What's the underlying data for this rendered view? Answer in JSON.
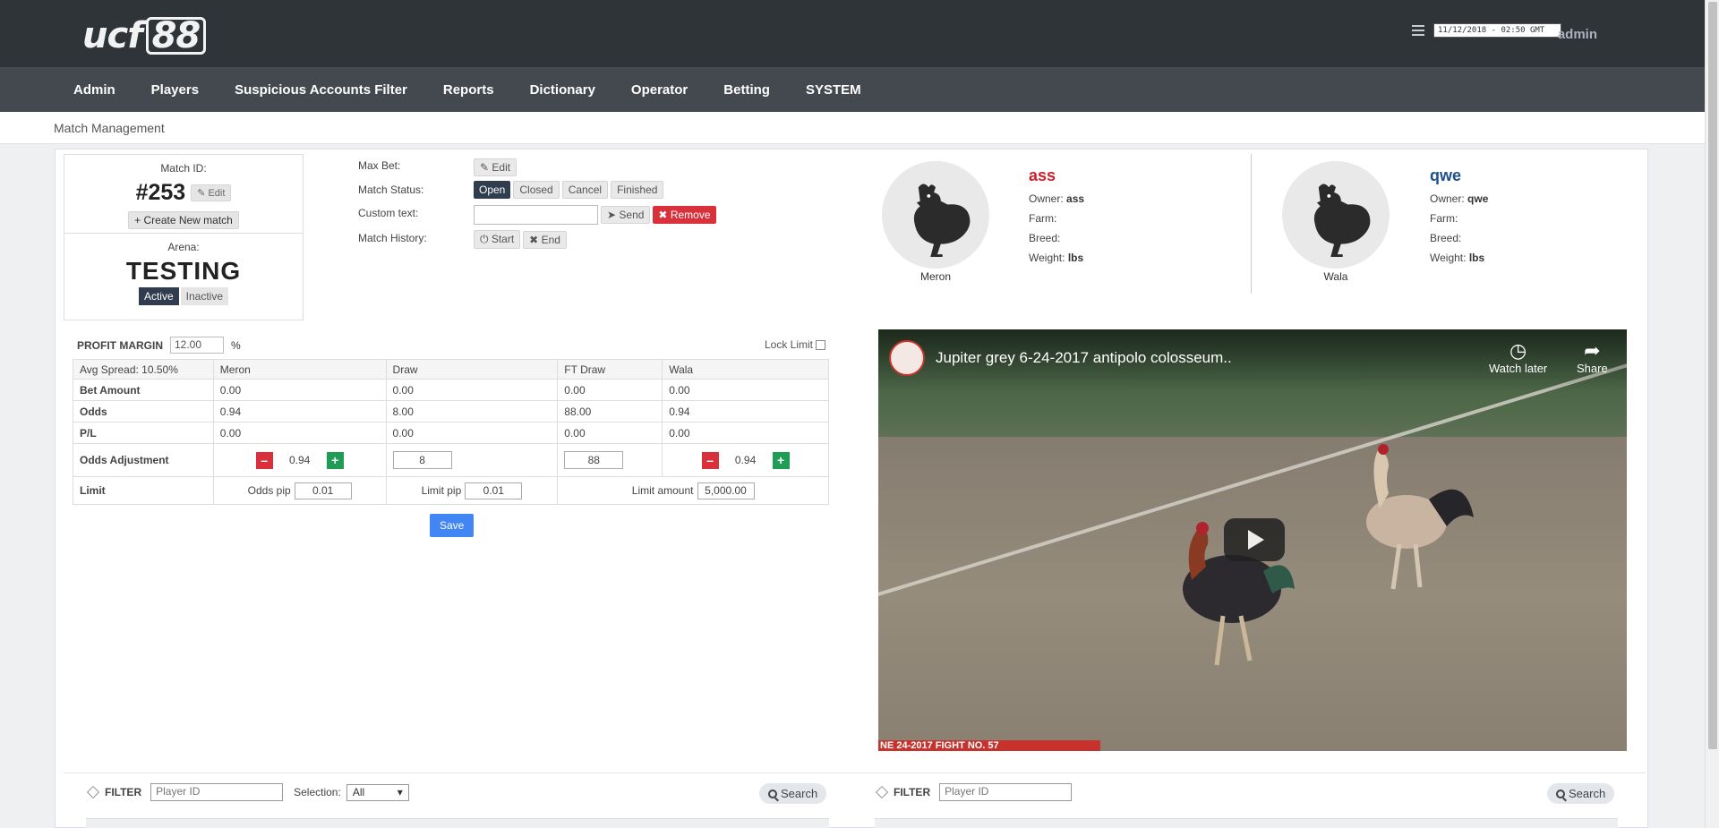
{
  "header": {
    "logo_main": "ucf",
    "logo_box": "88",
    "datetime": "11/12/2018 - 02:50 GMT",
    "user": "admin"
  },
  "nav": [
    "Admin",
    "Players",
    "Suspicious Accounts Filter",
    "Reports",
    "Dictionary",
    "Operator",
    "Betting",
    "SYSTEM"
  ],
  "breadcrumb": "Match Management",
  "match": {
    "id_label": "Match ID:",
    "id": "#253",
    "edit": "Edit",
    "create": "Create New match",
    "arena_label": "Arena:",
    "arena": "TESTING",
    "active": "Active",
    "inactive": "Inactive"
  },
  "controls": {
    "max_bet_label": "Max Bet:",
    "max_bet_edit": "Edit",
    "status_label": "Match Status:",
    "status_open": "Open",
    "status_closed": "Closed",
    "status_cancel": "Cancel",
    "status_finished": "Finished",
    "custom_label": "Custom text:",
    "send": "Send",
    "remove": "Remove",
    "history_label": "Match History:",
    "start": "Start",
    "end": "End"
  },
  "fighters": {
    "meron": {
      "side": "Meron",
      "name": "ass",
      "owner_label": "Owner:",
      "owner": "ass",
      "farm_label": "Farm:",
      "breed_label": "Breed:",
      "weight_label": "Weight:",
      "weight_unit": "lbs",
      "color": "#cc1f2b"
    },
    "wala": {
      "side": "Wala",
      "name": "qwe",
      "owner_label": "Owner:",
      "owner": "qwe",
      "farm_label": "Farm:",
      "breed_label": "Breed:",
      "weight_label": "Weight:",
      "weight_unit": "lbs",
      "color": "#1f4f8a"
    }
  },
  "odds": {
    "profit_label": "PROFIT MARGIN",
    "profit_value": "12.00",
    "profit_unit": "%",
    "lock_label": "Lock Limit",
    "headers": [
      "Avg Spread: 10.50%",
      "Meron",
      "Draw",
      "FT Draw",
      "Wala"
    ],
    "rows": [
      {
        "label": "Bet Amount",
        "values": [
          "0.00",
          "0.00",
          "0.00",
          "0.00"
        ]
      },
      {
        "label": "Odds",
        "values": [
          "0.94",
          "8.00",
          "88.00",
          "0.94"
        ]
      },
      {
        "label": "P/L",
        "values": [
          "0.00",
          "0.00",
          "0.00",
          "0.00"
        ]
      }
    ],
    "adjust_label": "Odds Adjustment",
    "adjust": {
      "meron": "0.94",
      "draw": "8",
      "ft_draw": "88",
      "wala": "0.94"
    },
    "limit_label": "Limit",
    "odds_pip_label": "Odds pip",
    "odds_pip": "0.01",
    "limit_pip_label": "Limit pip",
    "limit_pip": "0.01",
    "limit_amount_label": "Limit amount",
    "limit_amount": "5,000.00",
    "save": "Save"
  },
  "video": {
    "title": "Jupiter grey 6-24-2017 antipolo colosseum..",
    "watch_later": "Watch later",
    "share": "Share",
    "banner": "NE 24-2017 FIGHT NO. 57"
  },
  "filters": {
    "left": {
      "label": "FILTER",
      "placeholder": "Player ID",
      "selection_label": "Selection:",
      "selection_value": "All",
      "search": "Search"
    },
    "right": {
      "label": "FILTER",
      "placeholder": "Player ID",
      "search": "Search"
    }
  }
}
